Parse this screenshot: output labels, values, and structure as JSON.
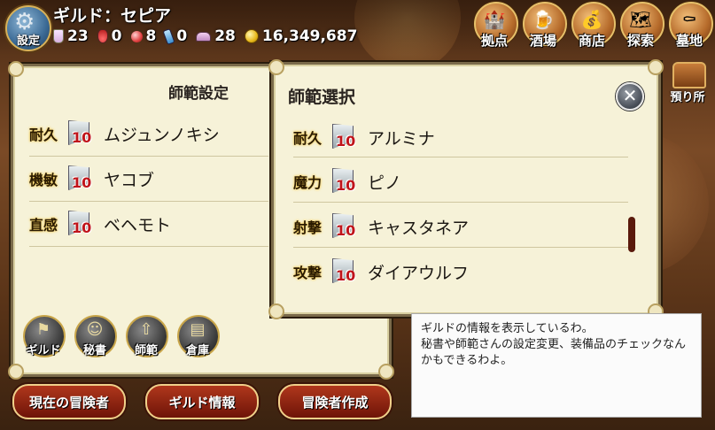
{
  "header": {
    "settings_label": "設定",
    "guild_name": "ギルド：セピア",
    "resources": [
      {
        "icon": "flask-icon",
        "value": "23"
      },
      {
        "icon": "potion-icon",
        "value": "0"
      },
      {
        "icon": "orb-icon",
        "value": "8"
      },
      {
        "icon": "vial-icon",
        "value": "0"
      },
      {
        "icon": "cloth-icon",
        "value": "28"
      },
      {
        "icon": "coin-icon",
        "value": "16,349,687"
      }
    ],
    "nav": [
      {
        "name": "base",
        "label": "拠点"
      },
      {
        "name": "tavern",
        "label": "酒場"
      },
      {
        "name": "shop",
        "label": "商店"
      },
      {
        "name": "explore",
        "label": "探索"
      },
      {
        "name": "graveyard",
        "label": "墓地"
      }
    ],
    "depot_label": "預り所"
  },
  "left_panel": {
    "title": "師範設定",
    "rows": [
      {
        "stat": "耐久",
        "level": "10",
        "name": "ムジュンノキシ"
      },
      {
        "stat": "機敏",
        "level": "10",
        "name": "ヤコブ"
      },
      {
        "stat": "直感",
        "level": "10",
        "name": "ベヘモト"
      }
    ]
  },
  "right_panel": {
    "title": "師範選択",
    "rows": [
      {
        "stat": "耐久",
        "level": "10",
        "name": "アルミナ"
      },
      {
        "stat": "魔力",
        "level": "10",
        "name": "ピノ"
      },
      {
        "stat": "射撃",
        "level": "10",
        "name": "キャスタネア"
      },
      {
        "stat": "攻撃",
        "level": "10",
        "name": "ダイアウルフ"
      }
    ]
  },
  "round_menu": [
    {
      "name": "guild",
      "label": "ギルド"
    },
    {
      "name": "secretary",
      "label": "秘書"
    },
    {
      "name": "master",
      "label": "師範"
    },
    {
      "name": "warehouse",
      "label": "倉庫"
    }
  ],
  "info": {
    "text": "ギルドの情報を表示しているわ。\n秘書や師範さんの設定変更、装備品のチェックなんかもできるわよ。"
  },
  "actions": {
    "current_adventurers": "現在の冒険者",
    "guild_info": "ギルド情報",
    "create_adventurer": "冒険者作成"
  }
}
